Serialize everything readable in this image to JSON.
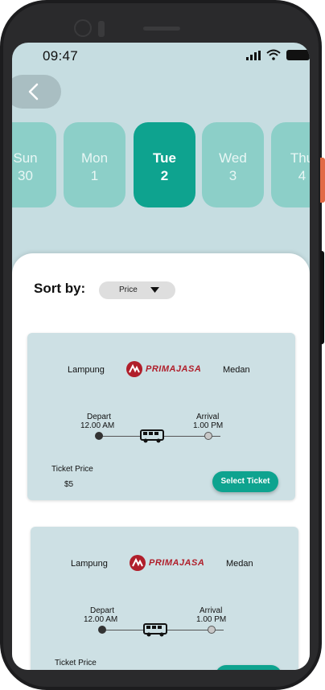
{
  "status_bar": {
    "time": "09:47"
  },
  "date_strip": {
    "days": [
      {
        "name": "Sun",
        "num": "30"
      },
      {
        "name": "Mon",
        "num": "1"
      },
      {
        "name": "Tue",
        "num": "2"
      },
      {
        "name": "Wed",
        "num": "3"
      },
      {
        "name": "Thu",
        "num": "4"
      }
    ],
    "selected_index": 2
  },
  "sort": {
    "label": "Sort by:",
    "value": "Price"
  },
  "tickets": [
    {
      "from": "Lampung",
      "to": "Medan",
      "operator": "PRIMAJASA",
      "depart_label": "Depart",
      "depart_time": "12.00 AM",
      "arrival_label": "Arrival",
      "arrival_time": "1.00 PM",
      "price_label": "Ticket Price",
      "price": "$5",
      "button": "Select Ticket"
    },
    {
      "from": "Lampung",
      "to": "Medan",
      "operator": "PRIMAJASA",
      "depart_label": "Depart",
      "depart_time": "12.00 AM",
      "arrival_label": "Arrival",
      "arrival_time": "1.00 PM",
      "price_label": "Ticket Price"
    }
  ],
  "colors": {
    "background": "#c6dde1",
    "accent": "#0ea38f",
    "day_inactive": "#8ccfc8",
    "brand_red": "#b01e2a"
  },
  "icons": [
    "back-arrow-icon",
    "signal-icon",
    "wifi-icon",
    "battery-icon",
    "caret-down-icon",
    "bus-icon",
    "primajasa-logo"
  ]
}
